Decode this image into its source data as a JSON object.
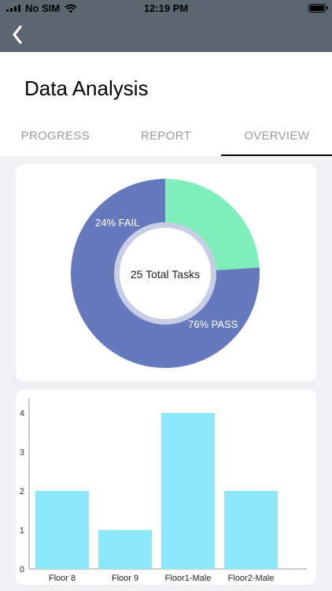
{
  "status_bar": {
    "carrier": "No SIM",
    "time": "12:19 PM"
  },
  "nav": {
    "back_icon": "chevron-left-icon"
  },
  "page": {
    "title": "Data Analysis"
  },
  "tabs": [
    {
      "label": "PROGRESS",
      "active": false
    },
    {
      "label": "REPORT",
      "active": false
    },
    {
      "label": "OVERVIEW",
      "active": true
    }
  ],
  "colors": {
    "nav": "#5b6670",
    "pass": "#6579bc",
    "fail": "#7eefba",
    "bar": "#8de8fb"
  },
  "chart_data": [
    {
      "type": "pie",
      "center_label": "25 Total Tasks",
      "slices": [
        {
          "label": "76% PASS",
          "value": 76,
          "color": "#6579bc"
        },
        {
          "label": "24% FAIL",
          "value": 24,
          "color": "#7eefba"
        }
      ]
    },
    {
      "type": "bar",
      "categories": [
        "Floor 8",
        "Floor 9",
        "Floor1-Male",
        "Floor2-Male"
      ],
      "values": [
        2,
        1,
        4,
        2
      ],
      "ylim": [
        0,
        4
      ],
      "yticks": [
        "0",
        "1",
        "2",
        "3",
        "4"
      ],
      "color": "#8de8fb"
    }
  ]
}
